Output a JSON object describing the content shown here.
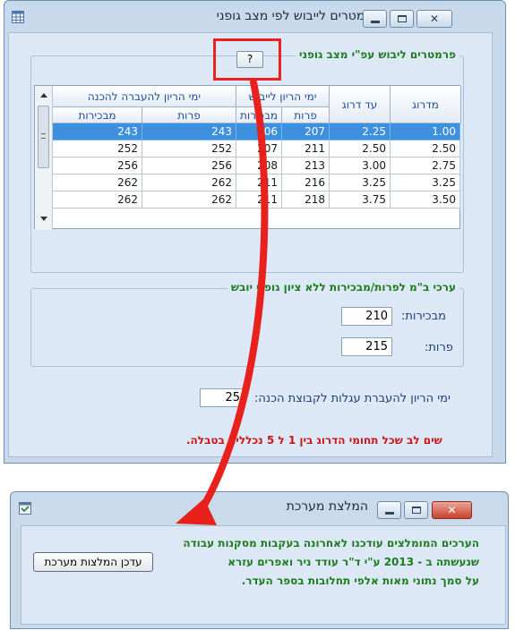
{
  "window1": {
    "title": "פרמטרים לייבוש לפי מצב גופני",
    "close_glyph": "✕",
    "group1_legend": "פרמטרים ליבוש עפ\"י מצב גופני",
    "help_button": "?",
    "grid": {
      "header_top": [
        "מדרוג",
        "עד דרוג",
        "ימי הריון לייבוש",
        "ימי הריון להעברה להכנה"
      ],
      "sub_headers": [
        "פרות",
        "מבכירות",
        "פרות",
        "מבכירות"
      ],
      "rows": [
        [
          "1.00",
          "2.25",
          "207",
          "206",
          "243",
          "243"
        ],
        [
          "2.50",
          "2.50",
          "211",
          "207",
          "252",
          "252"
        ],
        [
          "2.75",
          "3.00",
          "213",
          "208",
          "256",
          "256"
        ],
        [
          "3.25",
          "3.25",
          "216",
          "211",
          "262",
          "262"
        ],
        [
          "3.50",
          "3.75",
          "218",
          "211",
          "262",
          "262"
        ]
      ]
    },
    "group2_legend": "ערכי ב\"מ לפרות/מבכירות ללא ציון גופני יובש",
    "heifers_label": "מבכירות:",
    "heifers_value": "210",
    "cows_label": "פרות:",
    "cows_value": "215",
    "transfer_label": "ימי הריון להעברת עגלות לקבוצת הכנה:",
    "transfer_value": "25",
    "warning": "שים לב שכל תחומי הדרוג בין 1 ל 5 נכללים בטבלה."
  },
  "window2": {
    "title": "המלצת מערכת",
    "close_glyph": "✕",
    "text_lines": [
      "הערכים המומלצים עודכנו לאחרונה בעקבות מסקנות עבודה",
      "שנעשתה ב - 2013 ע\"י ד\"ר עודד ניר ואפרים עזרא",
      "על סמך נתוני מאות אלפי תחלובות בספר העדר."
    ],
    "update_button": "עדכן המלצות מערכת"
  },
  "colors": {
    "annotation": "#e8211d",
    "selection": "#3d8fe0",
    "legend_green": "#1d7b1d",
    "warning_red": "#cc1616"
  }
}
